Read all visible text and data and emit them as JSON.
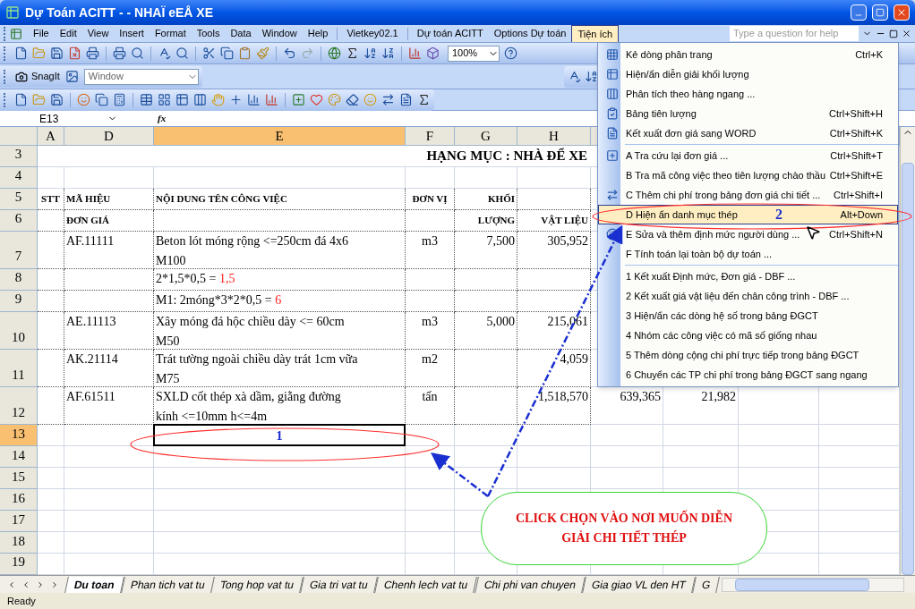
{
  "window": {
    "title": "Dự Toán ACITT -  - NHAÏ eEÅ XE"
  },
  "menubar": {
    "items": [
      {
        "label": "File",
        "selected": false
      },
      {
        "label": "Edit",
        "selected": false
      },
      {
        "label": "View",
        "selected": false
      },
      {
        "label": "Insert",
        "selected": false
      },
      {
        "label": "Format",
        "selected": false
      },
      {
        "label": "Tools",
        "selected": false
      },
      {
        "label": "Data",
        "selected": false
      },
      {
        "label": "Window",
        "selected": false
      },
      {
        "label": "Help",
        "selected": false
      },
      {
        "label": "Vietkey02.1",
        "selected": false
      },
      {
        "label": "Dự toán ACITT",
        "selected": false
      },
      {
        "label": "Options Dự toán",
        "selected": false
      },
      {
        "label": "Tiện ích",
        "selected": true
      }
    ],
    "help": {
      "placeholder": "Type a question for help"
    }
  },
  "toolbars": {
    "zoom": "100%",
    "snagit": "SnagIt",
    "capture_combo": "Window"
  },
  "formula_bar": {
    "name_box": "E13",
    "function_label": "fx"
  },
  "sheet": {
    "columns": [
      {
        "label": "A",
        "selected": false
      },
      {
        "label": "D",
        "selected": false
      },
      {
        "label": "E",
        "selected": true
      },
      {
        "label": "F",
        "selected": false
      },
      {
        "label": "G",
        "selected": false
      },
      {
        "label": "H",
        "selected": false
      }
    ],
    "rows": [
      {
        "header": "3",
        "selected": false,
        "kind": "title",
        "title": "HẠNG MỤC : NHÀ ĐỂ XE"
      },
      {
        "header": "4",
        "selected": false,
        "kind": "blank"
      },
      {
        "header": "5",
        "selected": false,
        "kind": "heading",
        "cells": {
          "A": "STT",
          "D": "MÃ HIỆU",
          "E": "NỘI DUNG TÊN CÔNG VIỆC",
          "F": "ĐƠN VỊ",
          "G": "KHỐI"
        }
      },
      {
        "header": "6",
        "selected": false,
        "kind": "heading",
        "cells": {
          "D": "ĐƠN GIÁ",
          "G": "LƯỢNG",
          "H": "VẬT LIỆU"
        }
      },
      {
        "header": "7",
        "selected": false,
        "kind": "item",
        "cells": {
          "D": "AF.11111",
          "E": "Beton lót móng rộng <=250cm đá 4x6\nM100",
          "F": "m3",
          "G": "7,500",
          "H": "305,952"
        }
      },
      {
        "header": "8",
        "selected": false,
        "kind": "item",
        "cells": {
          "E": {
            "text": "2*1,5*0,5 = ",
            "result": "1,5"
          }
        }
      },
      {
        "header": "9",
        "selected": false,
        "kind": "item",
        "cells": {
          "E": {
            "text": "M1: 2móng*3*2*0,5 = ",
            "result": "6"
          }
        }
      },
      {
        "header": "10",
        "selected": false,
        "kind": "item",
        "cells": {
          "D": "AE.11113",
          "E": "Xây móng đá hộc chiều dày <= 60cm\nM50",
          "F": "m3",
          "G": "5,000",
          "H": "215,061"
        }
      },
      {
        "header": "11",
        "selected": false,
        "kind": "item",
        "cells": {
          "D": "AK.21114",
          "E": "Trát tường ngoài chiều dày trát 1cm vữa\nM75",
          "F": "m2",
          "H": "4,059"
        }
      },
      {
        "header": "12",
        "selected": false,
        "kind": "item",
        "cells": {
          "D": "AF.61511",
          "E": "SXLD cốt thép xà dầm, giằng đường\nkính <=10mm h<=4m",
          "F": "tấn",
          "H": "1,518,570",
          "column_9": "639,365",
          "column_10": "21,982"
        }
      },
      {
        "header": "13",
        "selected": true,
        "kind": "blank"
      },
      {
        "header": "14",
        "selected": false,
        "kind": "blank"
      },
      {
        "header": "15",
        "selected": false,
        "kind": "blank"
      },
      {
        "header": "16",
        "selected": false,
        "kind": "blank"
      },
      {
        "header": "17",
        "selected": false,
        "kind": "blank"
      },
      {
        "header": "18",
        "selected": false,
        "kind": "blank"
      },
      {
        "header": "19",
        "selected": false,
        "kind": "blank"
      }
    ]
  },
  "menu": {
    "items": [
      {
        "kind": "item",
        "label": "Kẻ dòng phân trang",
        "shortcut": "Ctrl+K",
        "selected": false,
        "has_icon": true
      },
      {
        "kind": "item",
        "label": "Hiện/ẩn diễn giải khối lượng",
        "selected": false,
        "has_icon": true
      },
      {
        "kind": "item",
        "label": "Phân tích theo hàng ngang ...",
        "selected": false,
        "has_icon": true
      },
      {
        "kind": "item",
        "label": "Bảng tiên lượng",
        "shortcut": "Ctrl+Shift+H",
        "selected": false,
        "has_icon": true
      },
      {
        "kind": "item",
        "label": "Kết xuất đơn giá sang WORD",
        "shortcut": "Ctrl+Shift+K",
        "selected": false,
        "has_icon": true
      },
      {
        "kind": "separator"
      },
      {
        "kind": "item",
        "label": "A Tra cứu lại đơn giá ...",
        "shortcut": "Ctrl+Shift+T",
        "selected": false,
        "has_icon": true
      },
      {
        "kind": "item",
        "label": "B Tra mã công việc theo tiên lượng chào thầu",
        "shortcut": "Ctrl+Shift+E",
        "selected": false,
        "has_icon": false
      },
      {
        "kind": "item",
        "label": "C Thêm chi phí trong bảng đơn giá chi tiết ...",
        "shortcut": "Ctrl+Shift+I",
        "selected": false,
        "has_icon": true
      },
      {
        "kind": "item",
        "label": "D Hiện ẩn danh mục thép",
        "shortcut": "Alt+Down",
        "selected": true,
        "has_icon": false
      },
      {
        "kind": "item",
        "label": "E Sửa và thêm định mức người dùng ...",
        "shortcut": "Ctrl+Shift+N",
        "selected": false,
        "has_icon": true
      },
      {
        "kind": "item",
        "label": "F Tính toán lại toàn bộ dự toán ...",
        "selected": false,
        "has_icon": false
      },
      {
        "kind": "separator"
      },
      {
        "kind": "item",
        "label": "1 Kết xuất Định mức, Đơn giá - DBF ...",
        "selected": false,
        "has_icon": false
      },
      {
        "kind": "item",
        "label": "2 Kết xuất giá vật liệu đến chân công trình - DBF ...",
        "selected": false,
        "has_icon": false
      },
      {
        "kind": "item",
        "label": "3 Hiện/ẩn các dòng hệ số trong bảng ĐGCT",
        "selected": false,
        "has_icon": false
      },
      {
        "kind": "item",
        "label": "4 Nhóm các công việc có mã số giống nhau",
        "selected": false,
        "has_icon": false
      },
      {
        "kind": "item",
        "label": "5 Thêm dòng cộng chi phí trực tiếp trong bảng ĐGCT",
        "selected": false,
        "has_icon": false
      },
      {
        "kind": "item",
        "label": "6 Chuyển các TP chi phí trong bảng ĐGCT sang ngang",
        "selected": false,
        "has_icon": false
      }
    ]
  },
  "annotations": {
    "cell_marker": "1",
    "menu_marker": "2",
    "callout": "CLICK CHỌN VÀO NƠI MUỐN DIỄN GIẢI CHI TIẾT THÉP"
  },
  "sheet_tabs": [
    {
      "label": "Du toan",
      "selected": true
    },
    {
      "label": "Phan tich vat tu",
      "selected": false
    },
    {
      "label": "Tong hop vat tu",
      "selected": false
    },
    {
      "label": "Gia tri vat tu",
      "selected": false
    },
    {
      "label": "Chenh lech vat tu",
      "selected": false
    },
    {
      "label": "Chi phi van chuyen",
      "selected": false
    },
    {
      "label": "Gia giao VL den HT",
      "selected": false
    },
    {
      "label": "G",
      "selected": false
    }
  ],
  "status_bar": {
    "text": "Ready"
  }
}
